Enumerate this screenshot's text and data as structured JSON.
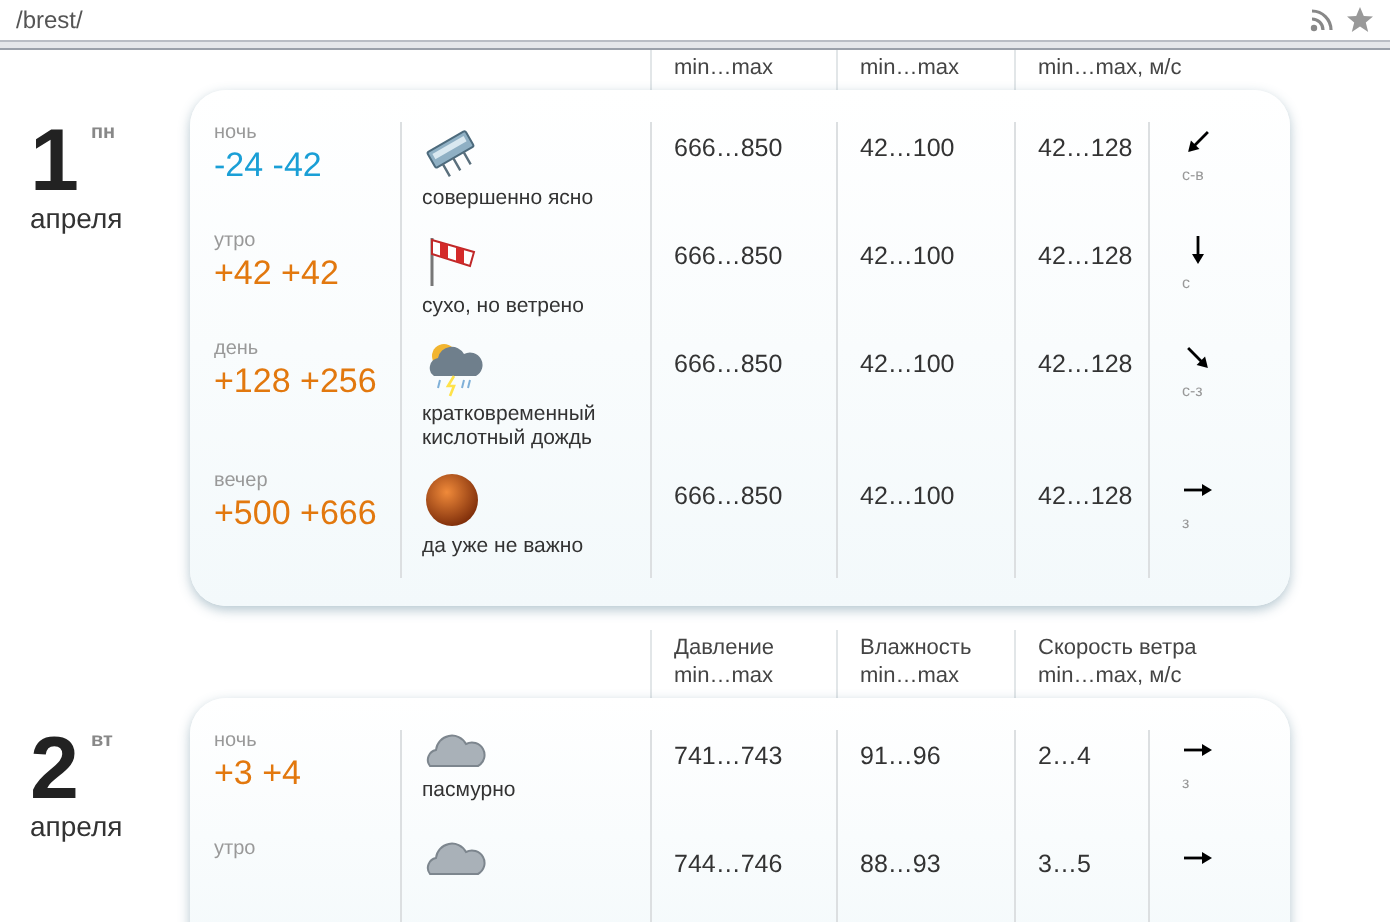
{
  "address_bar": {
    "url": "/brest/"
  },
  "days": [
    {
      "header": [
        {
          "lines": [
            "min…max"
          ]
        },
        {
          "lines": [
            "min…max"
          ]
        },
        {
          "lines": [
            "min…max, м/с"
          ]
        }
      ],
      "number": "1",
      "weekday": "пн",
      "month": "апреля",
      "periods": [
        {
          "name": "ночь",
          "temp": "-24 -42",
          "color": "#1a9fd6",
          "icon": {
            "kind": "gadget"
          },
          "condition": "совершенно ясно",
          "pressure": "666…850",
          "humidity": "42…100",
          "wind": "42…128",
          "wind_arrow": {
            "kind": "sw"
          },
          "direction": "с-в"
        },
        {
          "name": "утро",
          "temp": "+42 +42",
          "color": "#e2780e",
          "icon": {
            "kind": "windsock"
          },
          "condition": "сухо, но ветрено",
          "pressure": "666…850",
          "humidity": "42…100",
          "wind": "42…128",
          "wind_arrow": {
            "kind": "s"
          },
          "direction": "с"
        },
        {
          "name": "день",
          "temp": "+128 +256",
          "color": "#e2780e",
          "icon": {
            "kind": "storm"
          },
          "condition": "кратковременный кислотный дождь",
          "pressure": "666…850",
          "humidity": "42…100",
          "wind": "42…128",
          "wind_arrow": {
            "kind": "se"
          },
          "direction": "с-з"
        },
        {
          "name": "вечер",
          "temp": "+500 +666",
          "color": "#e2780e",
          "icon": {
            "kind": "planet"
          },
          "condition": "да уже не важно",
          "pressure": "666…850",
          "humidity": "42…100",
          "wind": "42…128",
          "wind_arrow": {
            "kind": "e"
          },
          "direction": "з"
        }
      ]
    },
    {
      "header": [
        {
          "lines": [
            "Давление",
            "min…max"
          ]
        },
        {
          "lines": [
            "Влажность",
            "min…max"
          ]
        },
        {
          "lines": [
            "Скорость ветра",
            "min…max, м/с"
          ]
        }
      ],
      "number": "2",
      "weekday": "вт",
      "month": "апреля",
      "periods": [
        {
          "name": "ночь",
          "temp": "+3 +4",
          "color": "#e2780e",
          "icon": {
            "kind": "cloud"
          },
          "condition": "пасмурно",
          "pressure": "741…743",
          "humidity": "91…96",
          "wind": "2…4",
          "wind_arrow": {
            "kind": "e"
          },
          "direction": "з"
        },
        {
          "name": "утро",
          "icon": {
            "kind": "cloud"
          },
          "pressure": "744…746",
          "humidity": "88…93",
          "wind": "3…5",
          "wind_arrow": {
            "kind": "e"
          }
        }
      ]
    }
  ]
}
